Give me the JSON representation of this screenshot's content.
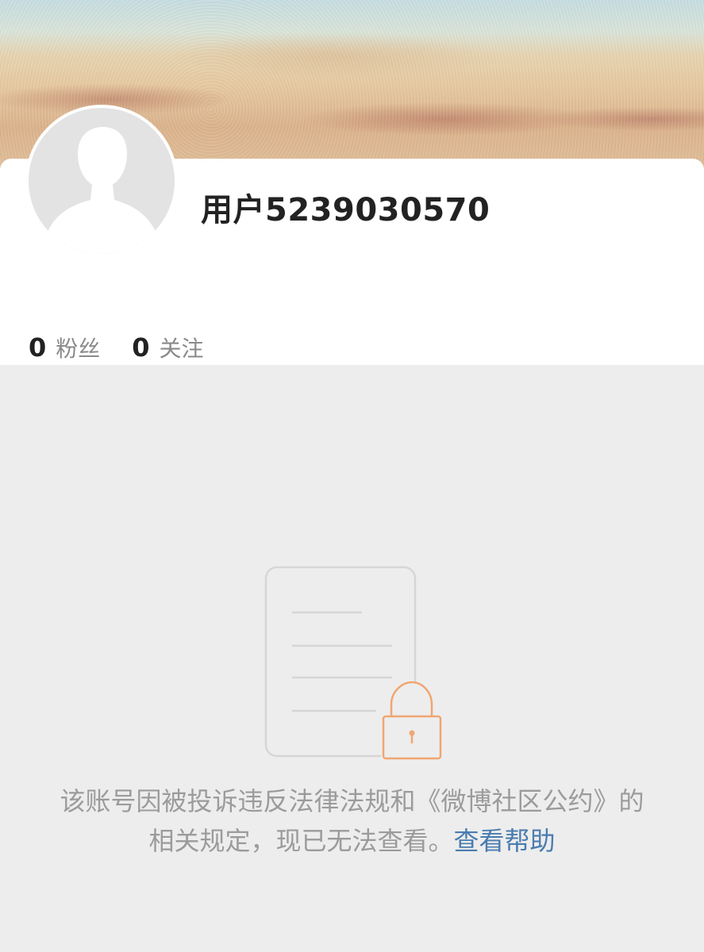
{
  "profile": {
    "username": "用户5239030570",
    "stats": [
      {
        "count": "0",
        "label": "粉丝"
      },
      {
        "count": "0",
        "label": "关注"
      }
    ]
  },
  "notice": {
    "message": "该账号因被投诉违反法律法规和《微博社区公约》的相关规定，现已无法查看。",
    "help_link": "查看帮助"
  },
  "colors": {
    "page_background": "#ededed",
    "card_background": "#ffffff",
    "link": "#4a7cb0",
    "lock_accent": "#f0a673",
    "notice_text": "#9b9b9b"
  },
  "icons": {
    "avatar": "default-user-silhouette",
    "empty_state": "locked-document-icon"
  }
}
